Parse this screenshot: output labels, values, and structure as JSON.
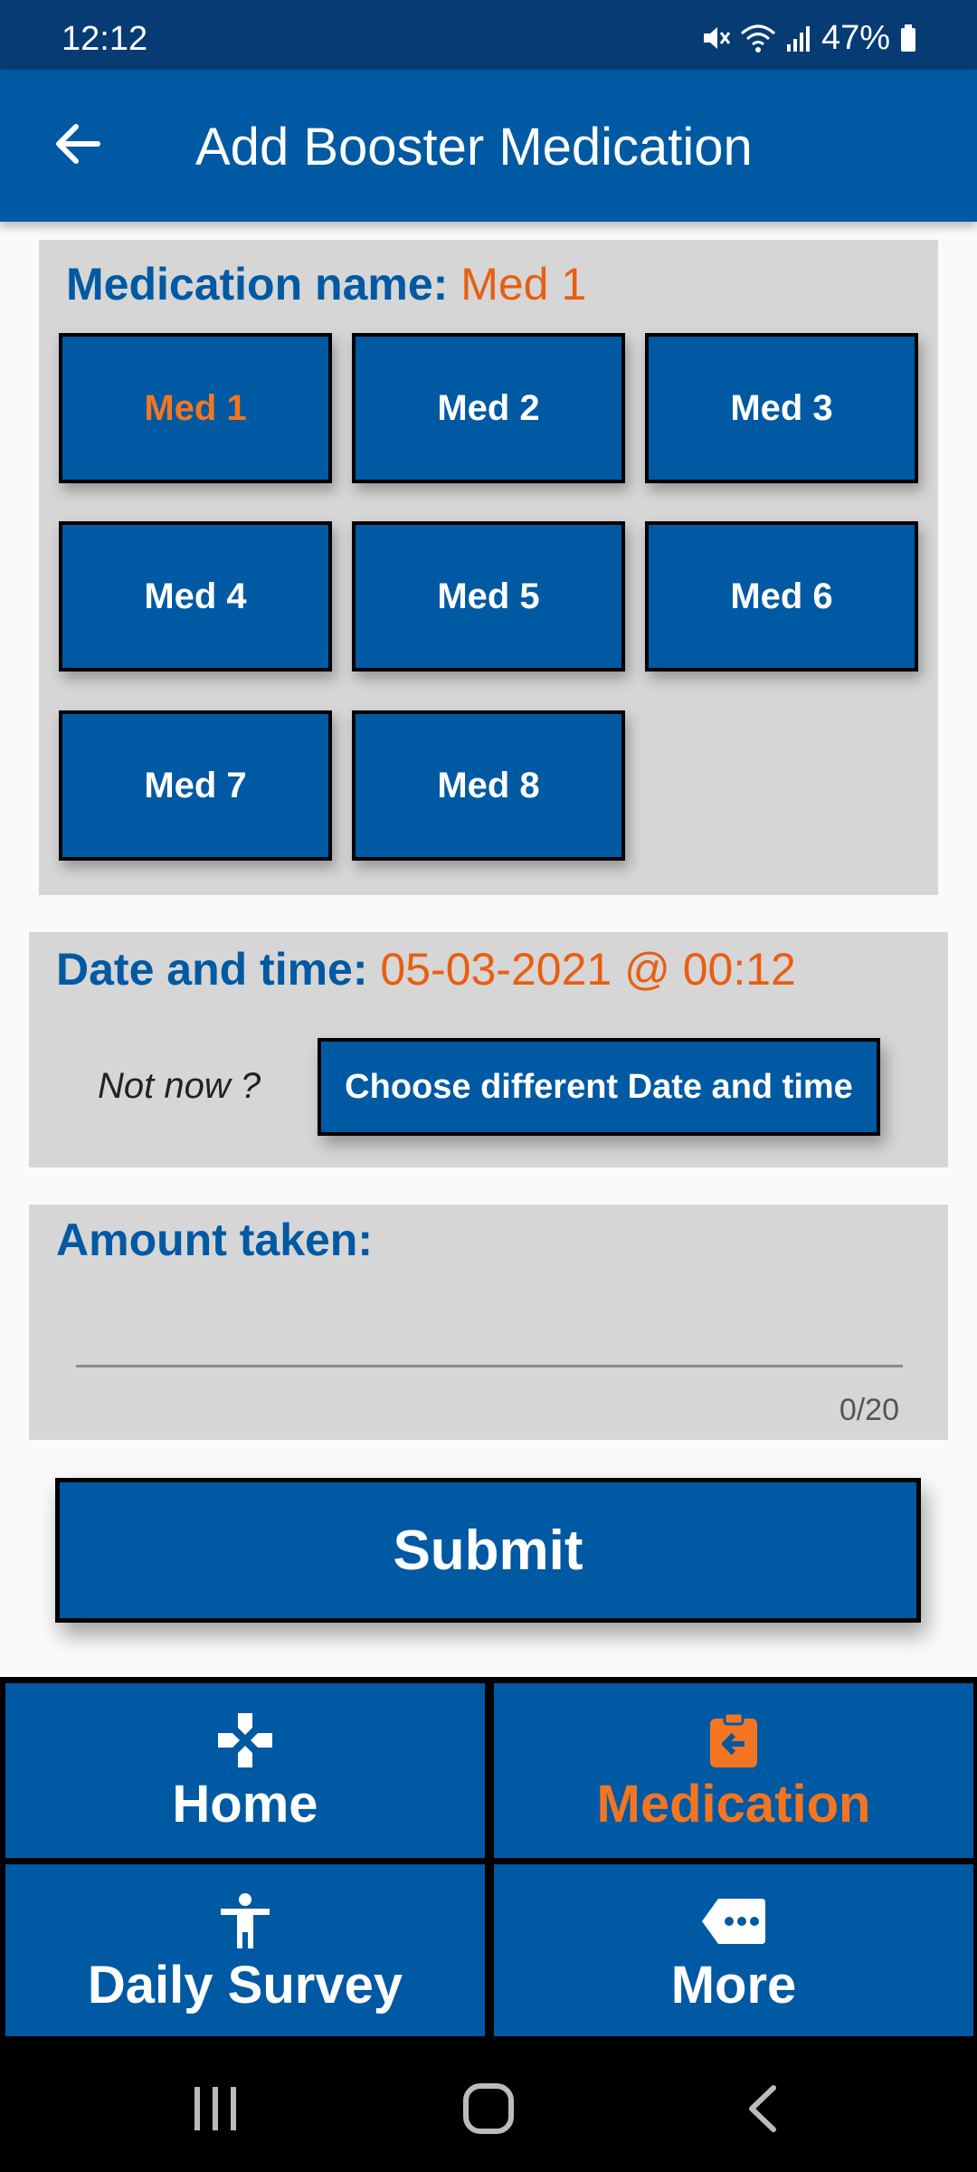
{
  "status_bar": {
    "time": "12:12",
    "battery": "47%",
    "icons": [
      "mute-icon",
      "wifi-icon",
      "signal-icon",
      "battery-icon"
    ]
  },
  "app_bar": {
    "title": "Add Booster Medication",
    "back_icon": "arrow-back-icon"
  },
  "medication": {
    "label": "Medication name:",
    "selected": "Med 1",
    "options": [
      "Med 1",
      "Med 2",
      "Med 3",
      "Med 4",
      "Med 5",
      "Med 6",
      "Med 7",
      "Med 8"
    ]
  },
  "datetime": {
    "label": "Date and time:",
    "value": "05-03-2021 @ 00:12",
    "not_now": "Not now ?",
    "choose_button": "Choose different Date and time"
  },
  "amount": {
    "label": "Amount taken:",
    "value": "",
    "counter": "0/20"
  },
  "submit_label": "Submit",
  "bottom_nav": {
    "active": "Medication",
    "items": [
      {
        "label": "Home",
        "icon": "home-cross-icon"
      },
      {
        "label": "Medication",
        "icon": "clipboard-arrow-icon"
      },
      {
        "label": "Daily Survey",
        "icon": "accessibility-person-icon"
      },
      {
        "label": "More",
        "icon": "more-tag-icon"
      }
    ]
  },
  "colors": {
    "primary": "#0059a3",
    "accent": "#f47521",
    "status_bar": "#063b73",
    "card_bg": "#d6d6d6"
  }
}
